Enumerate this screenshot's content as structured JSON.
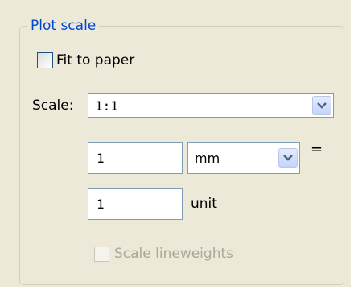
{
  "plot_scale": {
    "legend": "Plot scale",
    "fit_to_paper": {
      "label": "Fit to paper",
      "checked": false
    },
    "scale": {
      "label": "Scale:",
      "selected": "1:1"
    },
    "paper_value": "1",
    "paper_units": {
      "selected": "mm"
    },
    "equals": "=",
    "drawing_value": "1",
    "drawing_unit_label": "unit",
    "scale_lineweights": {
      "label": "Scale lineweights",
      "checked": false,
      "enabled": false
    }
  },
  "colors": {
    "panel_background": "#ece9d8",
    "legend_text": "#0046d5",
    "input_border": "#7f9db9",
    "disabled_text": "#aca899"
  },
  "icons": {
    "dropdown": "chevron-down-icon"
  }
}
